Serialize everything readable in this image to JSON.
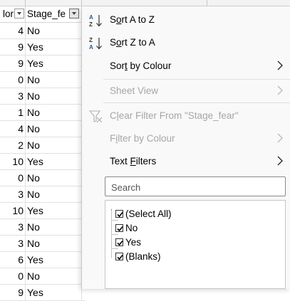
{
  "sheet": {
    "headers": {
      "col_a": "lor",
      "col_b": "Stage_fe"
    },
    "rows": [
      {
        "n": "4",
        "v": "No"
      },
      {
        "n": "9",
        "v": "Yes"
      },
      {
        "n": "9",
        "v": "Yes"
      },
      {
        "n": "0",
        "v": "No"
      },
      {
        "n": "3",
        "v": "No"
      },
      {
        "n": "1",
        "v": "No"
      },
      {
        "n": "4",
        "v": "No"
      },
      {
        "n": "2",
        "v": "No"
      },
      {
        "n": "10",
        "v": "Yes"
      },
      {
        "n": "0",
        "v": "No"
      },
      {
        "n": "3",
        "v": "No"
      },
      {
        "n": "10",
        "v": "Yes"
      },
      {
        "n": "3",
        "v": "No"
      },
      {
        "n": "3",
        "v": "No"
      },
      {
        "n": "6",
        "v": "Yes"
      },
      {
        "n": "0",
        "v": "No"
      },
      {
        "n": "9",
        "v": "Yes"
      }
    ]
  },
  "menu": {
    "sort_az": "Sort A to Z",
    "sort_za": "Sort Z to A",
    "sort_colour": "Sort by Colour",
    "sheet_view": "Sheet View",
    "clear_filter": "Clear Filter From \"Stage_fear\"",
    "filter_colour": "Filter by Colour",
    "text_filters": "Text Filters"
  },
  "search": {
    "placeholder": "Search"
  },
  "values": {
    "select_all": "(Select All)",
    "items": [
      "No",
      "Yes",
      "(Blanks)"
    ]
  },
  "colors": {
    "accent": "#2b579a",
    "disabled": "#a6a6a6"
  }
}
